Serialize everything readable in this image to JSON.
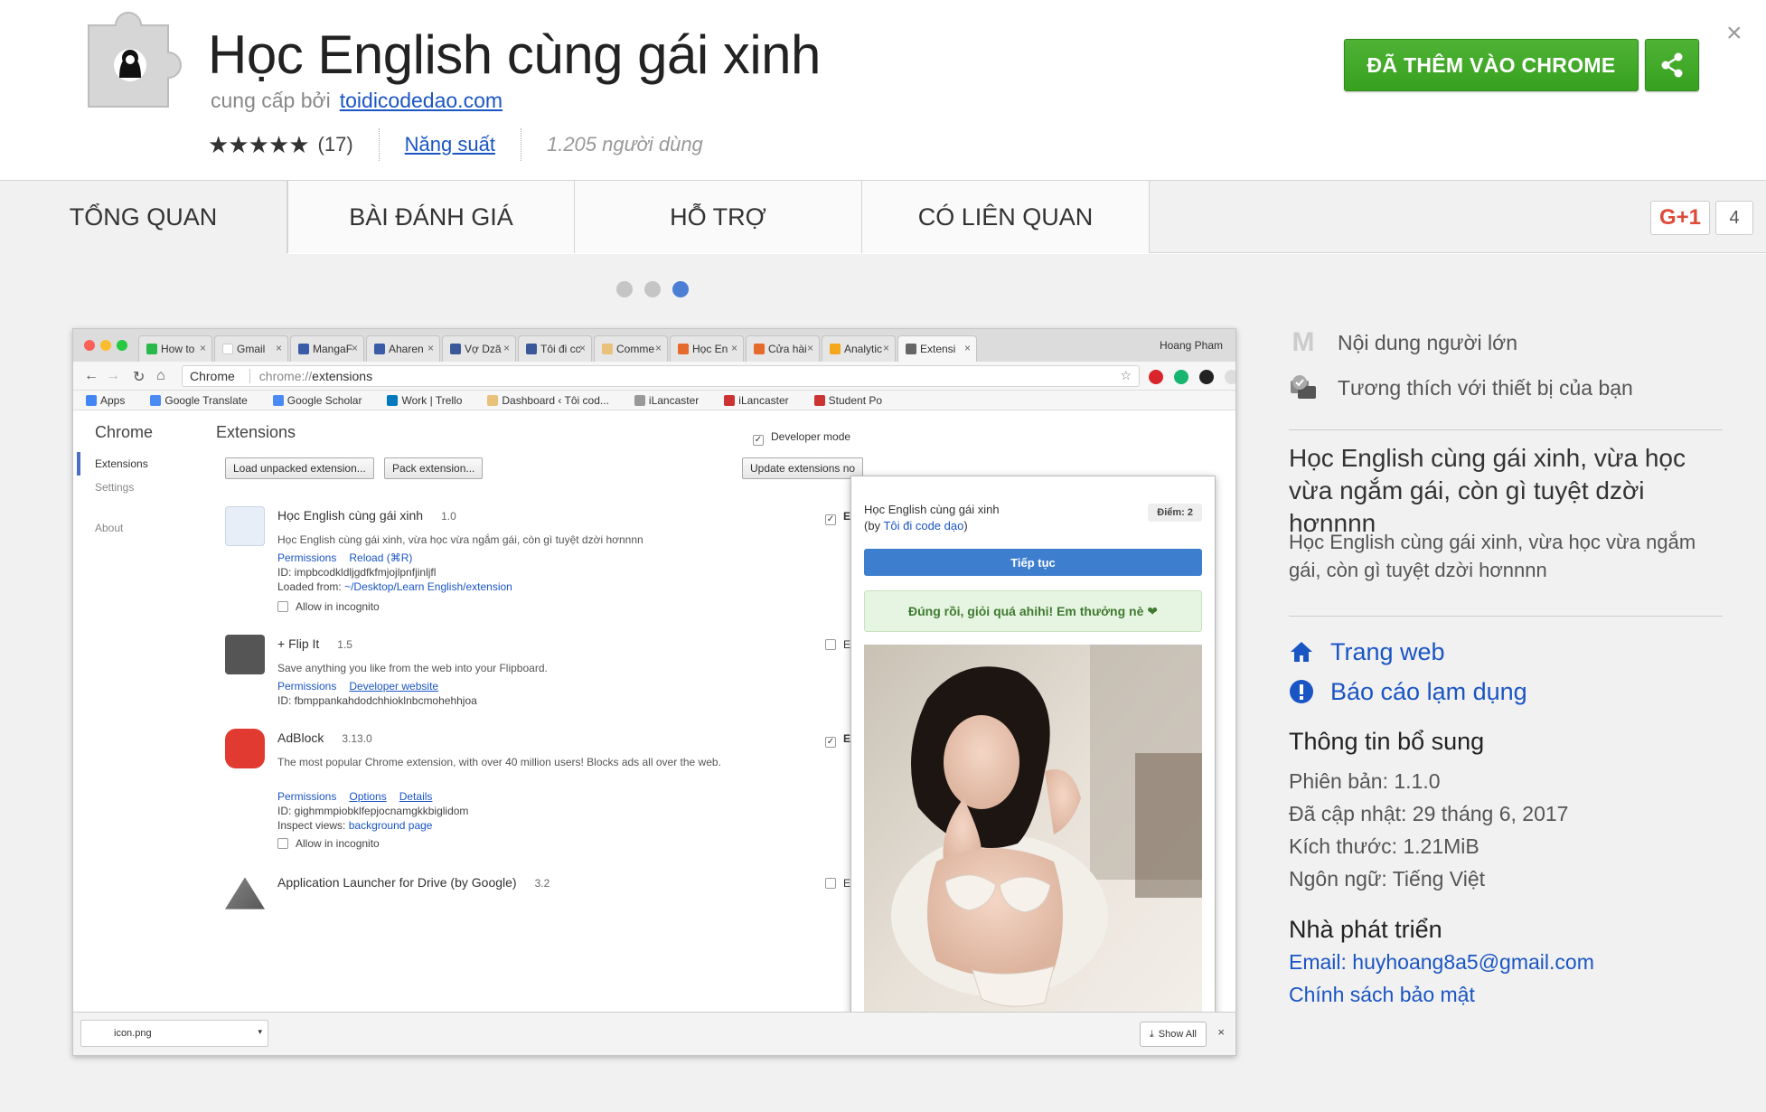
{
  "header": {
    "title": "Học English cùng gái xinh",
    "provided_by_label": "cung cấp bởi",
    "provider_link": "toidicodedao.com",
    "stars": "★★★★★",
    "rating_count": "(17)",
    "category": "Năng suất",
    "users": "1.205 người dùng",
    "add_button": "ĐÃ THÊM VÀO CHROME",
    "close": "×"
  },
  "tabs": [
    {
      "label": "TỔNG QUAN"
    },
    {
      "label": "BÀI ĐÁNH GIÁ"
    },
    {
      "label": "HỖ TRỢ"
    },
    {
      "label": "CÓ LIÊN QUAN"
    }
  ],
  "gplus": {
    "label": "G+1",
    "count": "4"
  },
  "carousel": {
    "active_index": 2,
    "count": 3
  },
  "screenshot": {
    "browser_tabs": [
      {
        "label": "How to"
      },
      {
        "label": "Gmail"
      },
      {
        "label": "MangaF"
      },
      {
        "label": "Aharen"
      },
      {
        "label": "Vợ Dză"
      },
      {
        "label": "Tôi đi cc"
      },
      {
        "label": "Comme"
      },
      {
        "label": "Học En"
      },
      {
        "label": "Cửa hài"
      },
      {
        "label": "Analytic"
      },
      {
        "label": "Extensi"
      }
    ],
    "profile": "Hoang Pham",
    "omnibox_origin": "Chrome",
    "omnibox_url_prefix": "chrome://",
    "omnibox_url_path": "extensions",
    "bookmarks": [
      "Apps",
      "Google Translate",
      "Google Scholar",
      "Work | Trello",
      "Dashboard ‹ Tôi cod...",
      "iLancaster",
      "iLancaster",
      "Student Po"
    ],
    "sidebar": {
      "title": "Chrome",
      "extensions": "Extensions",
      "settings": "Settings",
      "about": "About"
    },
    "page_title": "Extensions",
    "developer_mode": "Developer mode",
    "buttons": {
      "load_unpacked": "Load unpacked extension...",
      "pack": "Pack extension...",
      "update": "Update extensions no"
    },
    "extensions": [
      {
        "name": "Học English cùng gái xinh",
        "version": "1.0",
        "description": "Học English cùng gái xinh, vừa học vừa ngắm gái, còn gì tuyệt dzời hơnnnn",
        "link1": "Permissions",
        "link2": "Reload (⌘R)",
        "id_line": "ID: impbcodkldljgdfkfmjojlpnfjinljfl",
        "loaded_label": "Loaded from:",
        "loaded_path": "~/Desktop/Learn English/extension",
        "incognito": "Allow in incognito",
        "enable": "Enabled"
      },
      {
        "name": "+ Flip It",
        "version": "1.5",
        "description": "Save anything you like from the web into your Flipboard.",
        "link1": "Permissions",
        "link2": "Developer website",
        "id_line": "ID: fbmppankahdodchhioklnbcmohehhjoa",
        "enable": "Enable"
      },
      {
        "name": "AdBlock",
        "version": "3.13.0",
        "description": "The most popular Chrome extension, with over 40 million users! Blocks ads all over the web.",
        "link1": "Permissions",
        "link2": "Options",
        "link3": "Details",
        "id_line": "ID: gighmmpiobklfepjocnamgkkbiglidom",
        "inspect_label": "Inspect views:",
        "inspect_link": "background page",
        "incognito": "Allow in incognito",
        "enable": "Enabled"
      },
      {
        "name": "Application Launcher for Drive (by Google)",
        "version": "3.2",
        "enable": "Enable"
      }
    ],
    "popup": {
      "title": "Học English cùng gái xinh",
      "by_prefix": "(by ",
      "by_link": "Tôi đi code dạo",
      "by_suffix": ")",
      "score": "Điểm: 2",
      "continue": "Tiếp tục",
      "message": "Đúng rồi, giỏi quá ahihi! Em thưởng nè ❤"
    },
    "download": {
      "file": "icon.png",
      "show_all": "Show All",
      "close": "×"
    }
  },
  "sidebar_info": {
    "features": [
      "Nội dung người lớn",
      "Tương thích với thiết bị của bạn"
    ],
    "summary": "Học English cùng gái xinh, vừa học vừa ngắm gái, còn gì tuyệt dzời hơnnnn",
    "description": "Học English cùng gái xinh, vừa học vừa ngắm gái, còn gì tuyệt dzời hơnnnn",
    "links": [
      "Trang web",
      "Báo cáo lạm dụng"
    ],
    "additional_title": "Thông tin bổ sung",
    "version": "Phiên bản: 1.1.0",
    "updated": "Đã cập nhật: 29 tháng 6, 2017",
    "size": "Kích thước: 1.21MiB",
    "language": "Ngôn ngữ: Tiếng Việt",
    "developer_title": "Nhà phát triển",
    "email": "Email:  huyhoang8a5@gmail.com",
    "privacy": "Chính sách bảo mật"
  }
}
